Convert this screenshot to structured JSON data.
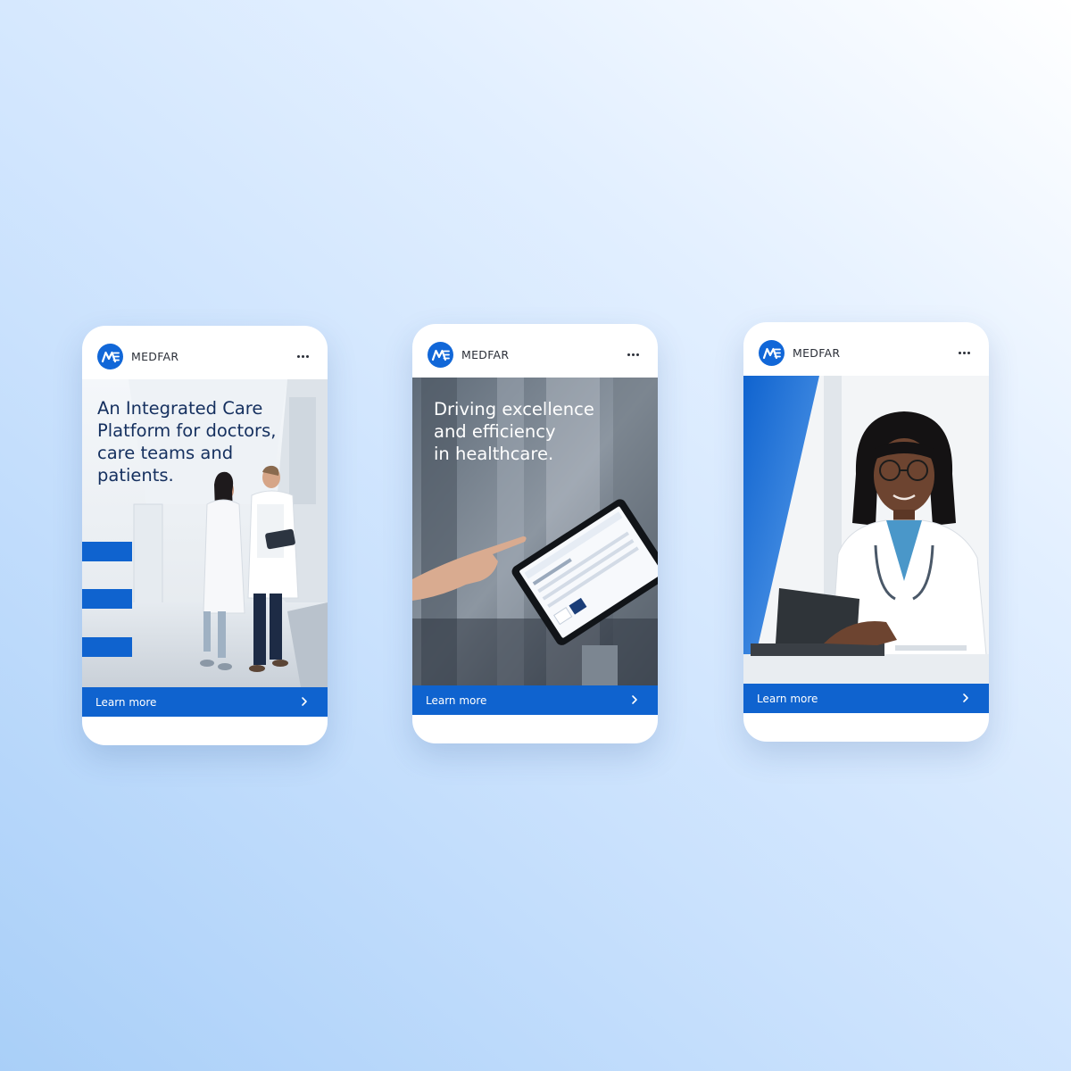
{
  "cards": [
    {
      "brand": "MEDFAR",
      "headline": "An Integrated Care\nPlatform for doctors,\ncare teams and\npatients.",
      "cta_label": "Learn more"
    },
    {
      "brand": "MEDFAR",
      "headline": "Driving excellence\nand efficiency\nin healthcare.",
      "cta_label": "Learn more"
    },
    {
      "brand": "MEDFAR",
      "headline": "",
      "cta_label": "Learn more"
    }
  ],
  "colors": {
    "brand_blue": "#0f63cf",
    "headline_dark": "#15305f",
    "headline_light": "#ffffff"
  },
  "icons": {
    "logo": "medfar-logo",
    "more": "more-options-icon",
    "arrow": "chevron-right-icon"
  }
}
